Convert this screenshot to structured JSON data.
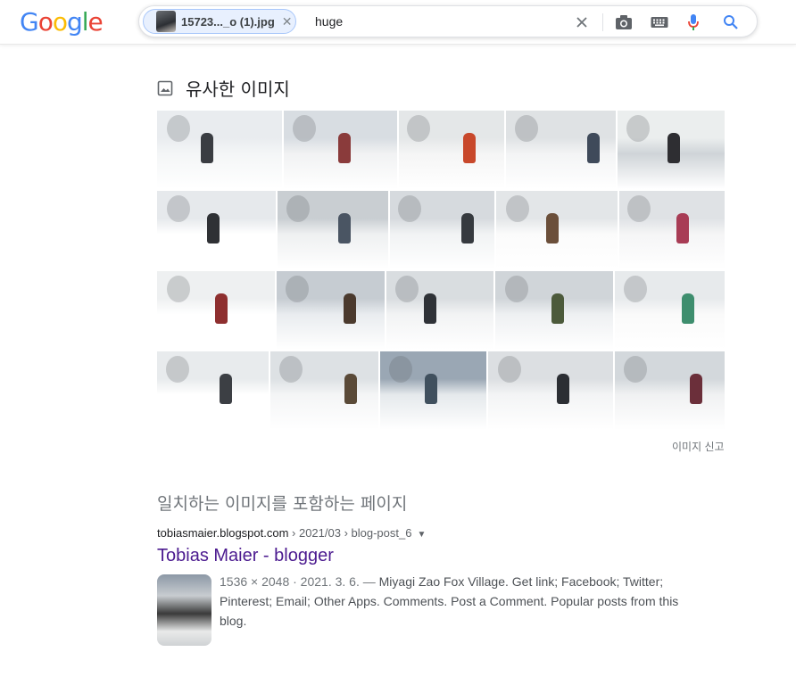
{
  "header": {
    "logo_letters": [
      {
        "ch": "G",
        "color": "#4285F4"
      },
      {
        "ch": "o",
        "color": "#EA4335"
      },
      {
        "ch": "o",
        "color": "#FBBC05"
      },
      {
        "ch": "g",
        "color": "#4285F4"
      },
      {
        "ch": "l",
        "color": "#34A853"
      },
      {
        "ch": "e",
        "color": "#EA4335"
      }
    ],
    "search": {
      "image_chip_name": "15723..._o (1).jpg",
      "query": "huge",
      "icons": [
        "clear-icon",
        "camera-icon",
        "keyboard-icon",
        "microphone-icon",
        "search-icon"
      ]
    }
  },
  "similar_images": {
    "title": "유사한 이미지",
    "report_link": "이미지 신고",
    "rows": [
      [
        {
          "w": 140,
          "palette": [
            "#e9ecef",
            "#f4f6f7",
            "#3a3d42"
          ]
        },
        {
          "w": 127,
          "palette": [
            "#d8dde2",
            "#f1f2f3",
            "#8a3b3b"
          ]
        },
        {
          "w": 118,
          "palette": [
            "#e4e7e8",
            "#f5f5f5",
            "#c8482b"
          ]
        },
        {
          "w": 123,
          "palette": [
            "#dfe2e4",
            "#f3f4f5",
            "#3f4a5a"
          ]
        },
        {
          "w": 120,
          "palette": [
            "#ebeeee",
            "#cfd4d8",
            "#2e2e32"
          ]
        }
      ],
      [
        {
          "w": 133,
          "palette": [
            "#e6e9ec",
            "#ffffff",
            "#2f3135"
          ]
        },
        {
          "w": 124,
          "palette": [
            "#c9ced2",
            "#eef0f1",
            "#4a5563"
          ]
        },
        {
          "w": 117,
          "palette": [
            "#d6dade",
            "#f1f3f4",
            "#363a3f"
          ]
        },
        {
          "w": 136,
          "palette": [
            "#e3e6e8",
            "#fbfbfb",
            "#6b4f3a"
          ]
        },
        {
          "w": 118,
          "palette": [
            "#dfe2e5",
            "#f5f5f6",
            "#a83c55"
          ]
        }
      ],
      [
        {
          "w": 132,
          "palette": [
            "#eef0f1",
            "#ffffff",
            "#8e2f2f"
          ]
        },
        {
          "w": 121,
          "palette": [
            "#c6ccd2",
            "#e9ecef",
            "#4b3a2e"
          ]
        },
        {
          "w": 120,
          "palette": [
            "#d9dde0",
            "#f2f3f4",
            "#2f3237"
          ]
        },
        {
          "w": 132,
          "palette": [
            "#d0d5d9",
            "#eef0f2",
            "#4c5a3b"
          ]
        },
        {
          "w": 123,
          "palette": [
            "#e7eaec",
            "#fafafa",
            "#3e8e6e"
          ]
        }
      ],
      [
        {
          "w": 125,
          "palette": [
            "#e8ebed",
            "#ffffff",
            "#3c3f44"
          ]
        },
        {
          "w": 121,
          "palette": [
            "#dde1e4",
            "#f4f5f6",
            "#5a4a38"
          ]
        },
        {
          "w": 119,
          "palette": [
            "#9aa7b4",
            "#e5e9ec",
            "#40505e"
          ]
        },
        {
          "w": 140,
          "palette": [
            "#dcdfe2",
            "#f3f4f5",
            "#2b2e33"
          ]
        },
        {
          "w": 123,
          "palette": [
            "#d3d8dc",
            "#f0f1f2",
            "#6b2f3a"
          ]
        }
      ]
    ]
  },
  "matching_pages": {
    "heading": "일치하는 이미지를 포함하는 페이지",
    "results": [
      {
        "site": "tobiasmaier.blogspot.com",
        "breadcrumb": " › 2021/03 › blog-post_6",
        "caret": "▼",
        "title": "Tobias Maier - blogger",
        "meta": "1536 × 2048 · 2021. 3. 6. — ",
        "snippet": "Miyagi Zao Fox Village. Get link; Facebook; Twitter; Pinterest; Email; Other Apps. Comments. Post a Comment. Popular posts from this blog."
      }
    ]
  }
}
